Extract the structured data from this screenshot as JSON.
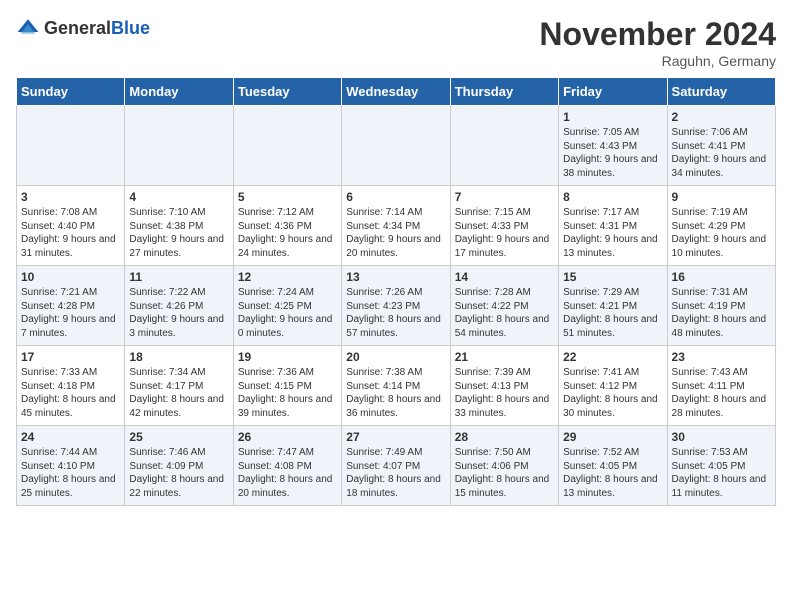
{
  "logo": {
    "general": "General",
    "blue": "Blue"
  },
  "header": {
    "month": "November 2024",
    "location": "Raguhn, Germany"
  },
  "days_of_week": [
    "Sunday",
    "Monday",
    "Tuesday",
    "Wednesday",
    "Thursday",
    "Friday",
    "Saturday"
  ],
  "weeks": [
    [
      {
        "day": "",
        "info": ""
      },
      {
        "day": "",
        "info": ""
      },
      {
        "day": "",
        "info": ""
      },
      {
        "day": "",
        "info": ""
      },
      {
        "day": "",
        "info": ""
      },
      {
        "day": "1",
        "info": "Sunrise: 7:05 AM\nSunset: 4:43 PM\nDaylight: 9 hours\nand 38 minutes."
      },
      {
        "day": "2",
        "info": "Sunrise: 7:06 AM\nSunset: 4:41 PM\nDaylight: 9 hours\nand 34 minutes."
      }
    ],
    [
      {
        "day": "3",
        "info": "Sunrise: 7:08 AM\nSunset: 4:40 PM\nDaylight: 9 hours\nand 31 minutes."
      },
      {
        "day": "4",
        "info": "Sunrise: 7:10 AM\nSunset: 4:38 PM\nDaylight: 9 hours\nand 27 minutes."
      },
      {
        "day": "5",
        "info": "Sunrise: 7:12 AM\nSunset: 4:36 PM\nDaylight: 9 hours\nand 24 minutes."
      },
      {
        "day": "6",
        "info": "Sunrise: 7:14 AM\nSunset: 4:34 PM\nDaylight: 9 hours\nand 20 minutes."
      },
      {
        "day": "7",
        "info": "Sunrise: 7:15 AM\nSunset: 4:33 PM\nDaylight: 9 hours\nand 17 minutes."
      },
      {
        "day": "8",
        "info": "Sunrise: 7:17 AM\nSunset: 4:31 PM\nDaylight: 9 hours\nand 13 minutes."
      },
      {
        "day": "9",
        "info": "Sunrise: 7:19 AM\nSunset: 4:29 PM\nDaylight: 9 hours\nand 10 minutes."
      }
    ],
    [
      {
        "day": "10",
        "info": "Sunrise: 7:21 AM\nSunset: 4:28 PM\nDaylight: 9 hours\nand 7 minutes."
      },
      {
        "day": "11",
        "info": "Sunrise: 7:22 AM\nSunset: 4:26 PM\nDaylight: 9 hours\nand 3 minutes."
      },
      {
        "day": "12",
        "info": "Sunrise: 7:24 AM\nSunset: 4:25 PM\nDaylight: 9 hours\nand 0 minutes."
      },
      {
        "day": "13",
        "info": "Sunrise: 7:26 AM\nSunset: 4:23 PM\nDaylight: 8 hours\nand 57 minutes."
      },
      {
        "day": "14",
        "info": "Sunrise: 7:28 AM\nSunset: 4:22 PM\nDaylight: 8 hours\nand 54 minutes."
      },
      {
        "day": "15",
        "info": "Sunrise: 7:29 AM\nSunset: 4:21 PM\nDaylight: 8 hours\nand 51 minutes."
      },
      {
        "day": "16",
        "info": "Sunrise: 7:31 AM\nSunset: 4:19 PM\nDaylight: 8 hours\nand 48 minutes."
      }
    ],
    [
      {
        "day": "17",
        "info": "Sunrise: 7:33 AM\nSunset: 4:18 PM\nDaylight: 8 hours\nand 45 minutes."
      },
      {
        "day": "18",
        "info": "Sunrise: 7:34 AM\nSunset: 4:17 PM\nDaylight: 8 hours\nand 42 minutes."
      },
      {
        "day": "19",
        "info": "Sunrise: 7:36 AM\nSunset: 4:15 PM\nDaylight: 8 hours\nand 39 minutes."
      },
      {
        "day": "20",
        "info": "Sunrise: 7:38 AM\nSunset: 4:14 PM\nDaylight: 8 hours\nand 36 minutes."
      },
      {
        "day": "21",
        "info": "Sunrise: 7:39 AM\nSunset: 4:13 PM\nDaylight: 8 hours\nand 33 minutes."
      },
      {
        "day": "22",
        "info": "Sunrise: 7:41 AM\nSunset: 4:12 PM\nDaylight: 8 hours\nand 30 minutes."
      },
      {
        "day": "23",
        "info": "Sunrise: 7:43 AM\nSunset: 4:11 PM\nDaylight: 8 hours\nand 28 minutes."
      }
    ],
    [
      {
        "day": "24",
        "info": "Sunrise: 7:44 AM\nSunset: 4:10 PM\nDaylight: 8 hours\nand 25 minutes."
      },
      {
        "day": "25",
        "info": "Sunrise: 7:46 AM\nSunset: 4:09 PM\nDaylight: 8 hours\nand 22 minutes."
      },
      {
        "day": "26",
        "info": "Sunrise: 7:47 AM\nSunset: 4:08 PM\nDaylight: 8 hours\nand 20 minutes."
      },
      {
        "day": "27",
        "info": "Sunrise: 7:49 AM\nSunset: 4:07 PM\nDaylight: 8 hours\nand 18 minutes."
      },
      {
        "day": "28",
        "info": "Sunrise: 7:50 AM\nSunset: 4:06 PM\nDaylight: 8 hours\nand 15 minutes."
      },
      {
        "day": "29",
        "info": "Sunrise: 7:52 AM\nSunset: 4:05 PM\nDaylight: 8 hours\nand 13 minutes."
      },
      {
        "day": "30",
        "info": "Sunrise: 7:53 AM\nSunset: 4:05 PM\nDaylight: 8 hours\nand 11 minutes."
      }
    ]
  ]
}
